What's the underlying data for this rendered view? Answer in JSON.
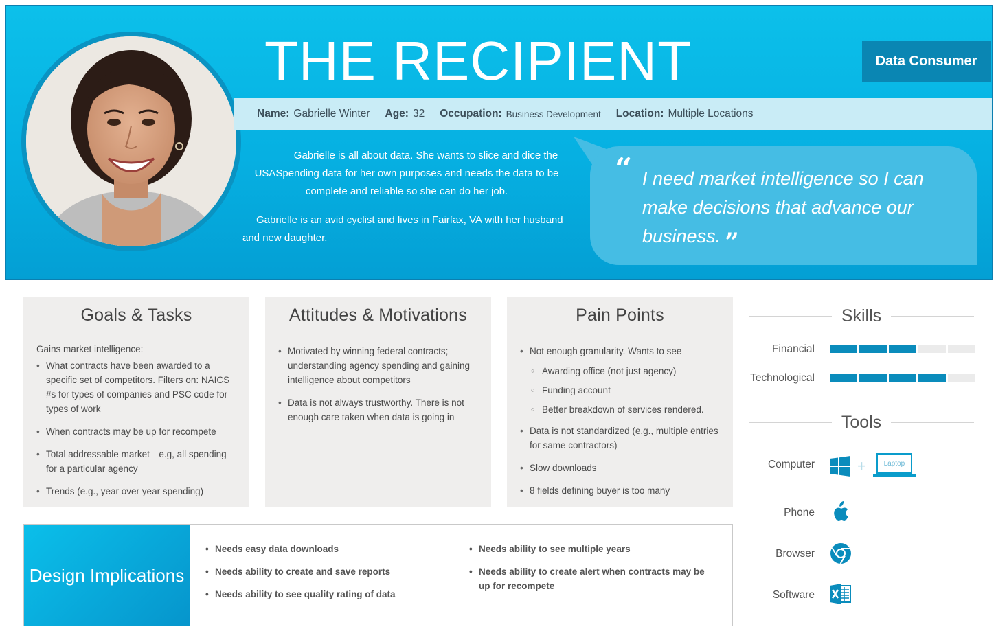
{
  "header": {
    "title": "THE RECIPIENT",
    "badge": "Data Consumer"
  },
  "profile": {
    "name_label": "Name:",
    "name": "Gabrielle Winter",
    "age_label": "Age:",
    "age": "32",
    "occupation_label": "Occupation:",
    "occupation": "Business Development",
    "location_label": "Location:",
    "location": "Multiple Locations"
  },
  "bio": {
    "p1": "Gabrielle is all about data.  She wants to slice and dice the USASpending data for her own purposes and needs the data to be complete and reliable so she can do her job.",
    "p2": "Gabrielle is an avid cyclist and lives in Fairfax, VA with her husband and new daughter."
  },
  "quote": {
    "open": "“",
    "text": "I need market intelligence so I can make decisions that advance our business.",
    "close": "”"
  },
  "goals": {
    "title": "Goals & Tasks",
    "lead": "Gains market intelligence:",
    "items": [
      "What contracts have been awarded to a specific set of competitors. Filters on: NAICS #s for types of companies and PSC code for types of work",
      "When contracts may be up for recompete",
      "Total addressable market—e.g, all spending for a particular agency",
      "Trends (e.g., year over year spending)"
    ]
  },
  "attitudes": {
    "title": "Attitudes & Motivations",
    "items": [
      "Motivated by winning federal contracts; understanding agency spending and gaining intelligence about competitors",
      "Data is not always trustworthy. There is not enough care taken when data is going in"
    ]
  },
  "pain": {
    "title": "Pain Points",
    "item1": "Not enough granularity. Wants to see",
    "sub": [
      "Awarding office (not just agency)",
      "Funding account",
      "Better breakdown of services rendered."
    ],
    "items": [
      "Data is not standardized (e.g., multiple entries for same contractors)",
      "Slow downloads",
      "8 fields defining buyer is too many"
    ]
  },
  "design": {
    "title": "Design Implications",
    "col1": [
      "Needs easy data downloads",
      "Needs ability to create and save reports",
      "Needs ability to see quality rating of data"
    ],
    "col2": [
      "Needs ability to see multiple years",
      "Needs ability to create alert when contracts may be up for recompete"
    ]
  },
  "skills": {
    "title": "Skills",
    "rows": [
      {
        "label": "Financial",
        "level": 3,
        "max": 5
      },
      {
        "label": "Technological",
        "level": 4,
        "max": 5
      }
    ]
  },
  "tools": {
    "title": "Tools",
    "computer_label": "Computer",
    "laptop_text": "Laptop",
    "plus": "+",
    "phone_label": "Phone",
    "browser_label": "Browser",
    "software_label": "Software",
    "icons": [
      "windows-icon",
      "laptop-icon",
      "apple-icon",
      "chrome-icon",
      "excel-icon"
    ]
  },
  "colors": {
    "primary": "#06b0e2",
    "accent_dark": "#0a86b3",
    "skill_on": "#0a8cbc",
    "skill_off": "#ebebeb",
    "card_bg": "#efeeed"
  }
}
